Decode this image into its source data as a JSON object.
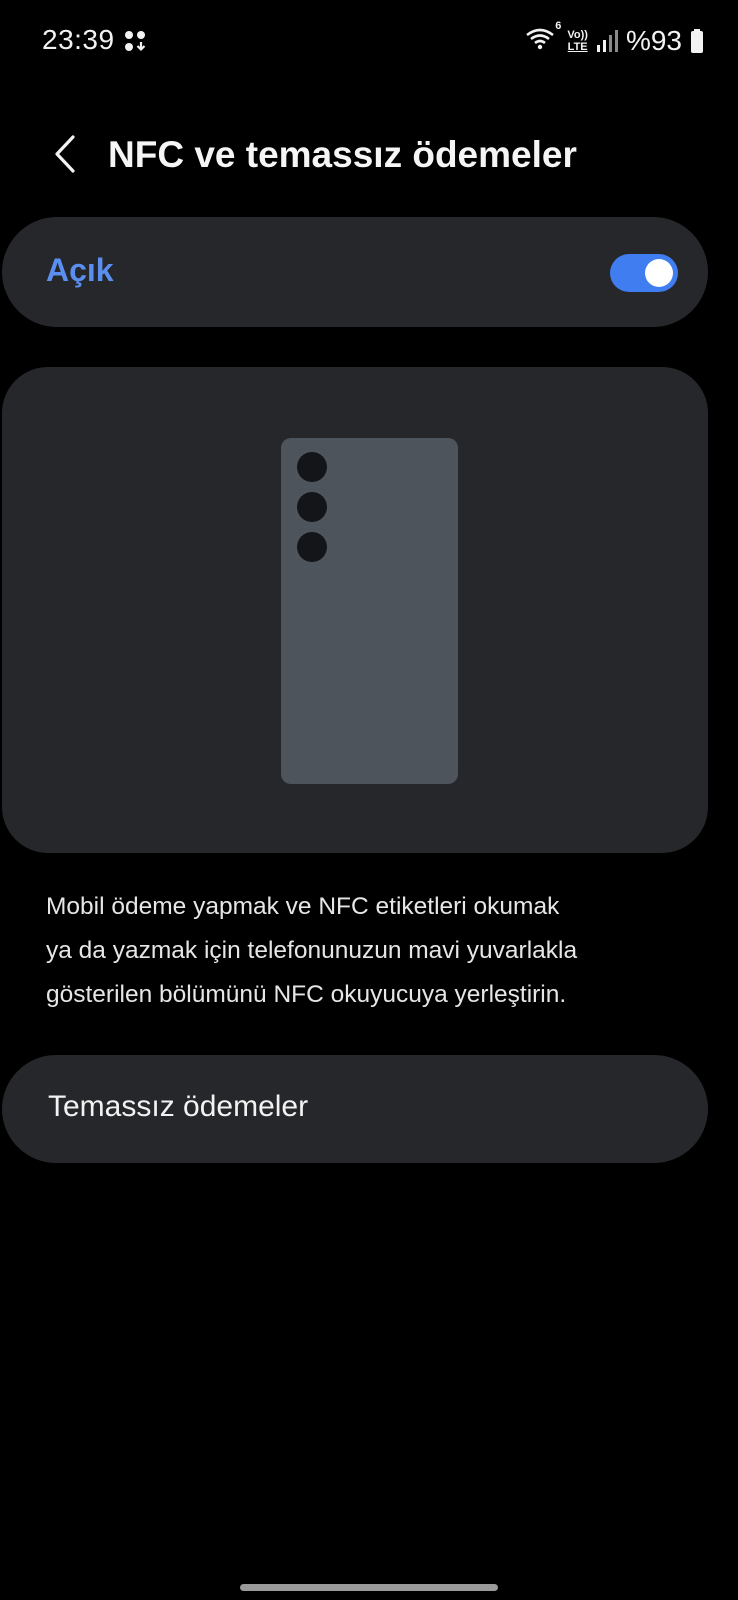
{
  "status_bar": {
    "time": "23:39",
    "battery_text": "%93",
    "lte_label": "LTE",
    "volte_label": "Vo))",
    "wifi_badge": "6",
    "icons": [
      "notification-dots-icon",
      "wifi-icon",
      "volte-lte-icon",
      "signal-icon",
      "battery-icon"
    ]
  },
  "header": {
    "title": "NFC ve temassız ödemeler"
  },
  "nfc_toggle": {
    "label": "Açık",
    "state": "on",
    "accent_color": "#3f7df0"
  },
  "illustration": {
    "description": "phone-back-with-cameras"
  },
  "description": {
    "text": "Mobil ödeme yapmak ve NFC etiketleri okumak\nya da yazmak için telefonunuzun mavi yuvarlakla\ngösterilen bölümünü NFC okuyucuya yerleştirin."
  },
  "payments": {
    "label": "Temassız ödemeler"
  }
}
